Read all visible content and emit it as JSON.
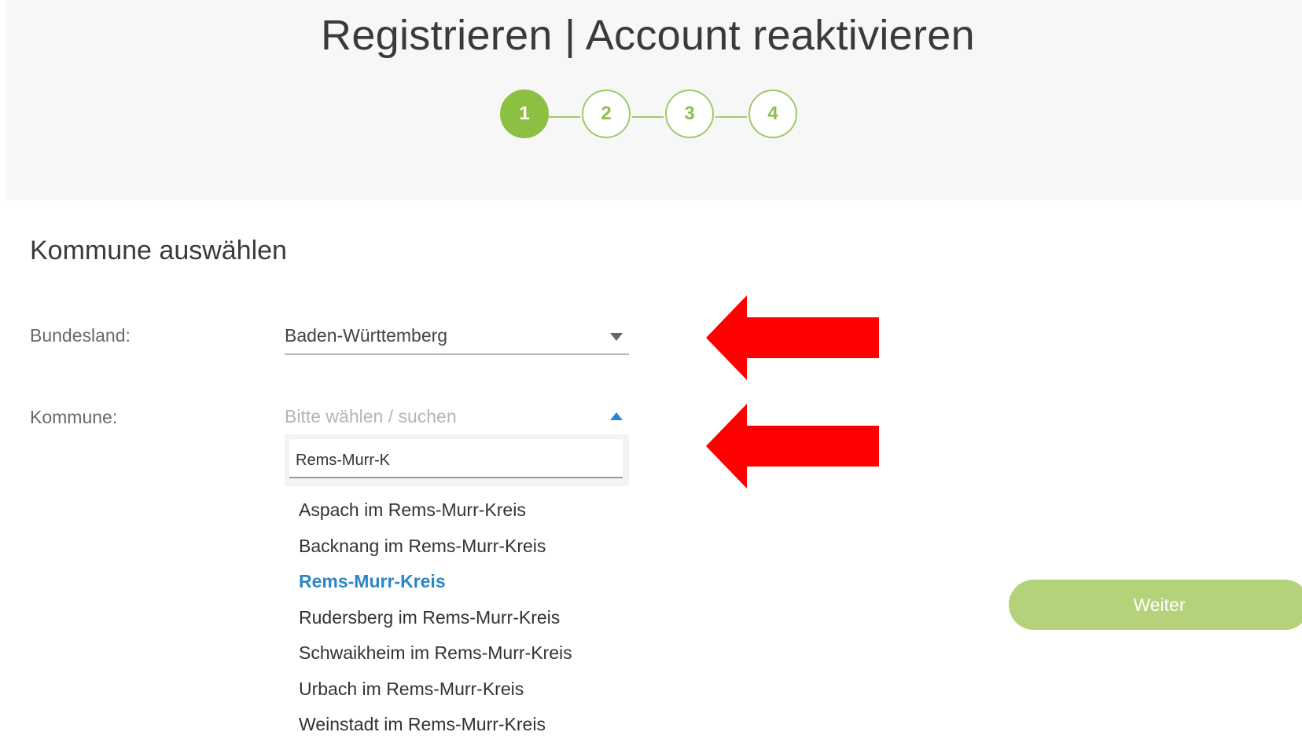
{
  "header": {
    "title": "Registrieren | Account reaktivieren",
    "steps": [
      {
        "label": "1",
        "active": true
      },
      {
        "label": "2",
        "active": false
      },
      {
        "label": "3",
        "active": false
      },
      {
        "label": "4",
        "active": false
      }
    ]
  },
  "form": {
    "section_title": "Kommune auswählen",
    "bundesland": {
      "label": "Bundesland:",
      "value": "Baden-Württemberg"
    },
    "kommune": {
      "label": "Kommune:",
      "placeholder": "Bitte wählen / suchen",
      "search_value": "Rems-Murr-K",
      "options": [
        {
          "label": "Aspach im Rems-Murr-Kreis"
        },
        {
          "label": "Backnang im Rems-Murr-Kreis"
        },
        {
          "label": "Rems-Murr-Kreis",
          "selected": true
        },
        {
          "label": "Rudersberg im Rems-Murr-Kreis"
        },
        {
          "label": "Schwaikheim im Rems-Murr-Kreis"
        },
        {
          "label": "Urbach im Rems-Murr-Kreis"
        },
        {
          "label": "Weinstadt im Rems-Murr-Kreis"
        }
      ]
    }
  },
  "actions": {
    "next_label": "Weiter"
  },
  "colors": {
    "accent_green": "#8dbf42",
    "button_green": "#b4d27a",
    "focus_blue": "#2b86c5",
    "annotation_red": "#ff0000"
  }
}
